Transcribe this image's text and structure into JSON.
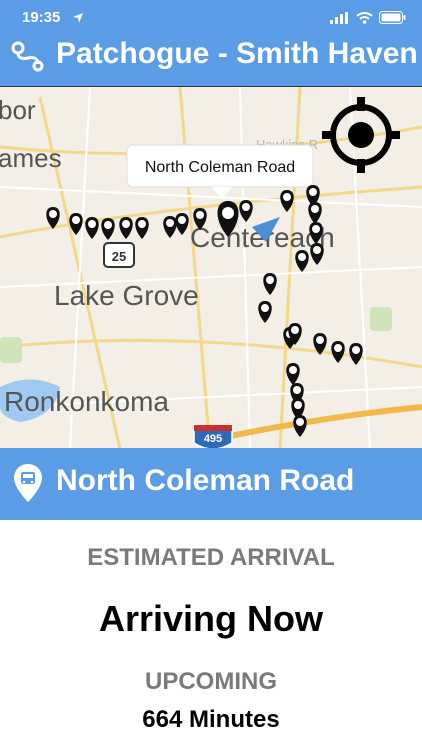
{
  "status_bar": {
    "time": "19:35"
  },
  "header": {
    "route_title": "Patchogue - Smith Haven"
  },
  "map": {
    "place_labels": [
      "bor",
      "ames",
      "Centereach",
      "Lake Grove",
      "Ronkonkoma",
      "Hawkins R"
    ],
    "shields": [
      "25",
      "495"
    ],
    "callout": "North Coleman Road",
    "icons": [
      "location-crosshair-icon",
      "bus-stop-pin-icon",
      "bus-direction-arrow-icon"
    ]
  },
  "stop": {
    "name": "North Coleman Road"
  },
  "arrival": {
    "label": "ESTIMATED ARRIVAL",
    "value": "Arriving Now",
    "upcoming_label": "UPCOMING",
    "upcoming_value": "664 Minutes"
  },
  "colors": {
    "accent": "#5a9de6",
    "muted_text": "#7a7a7a"
  }
}
